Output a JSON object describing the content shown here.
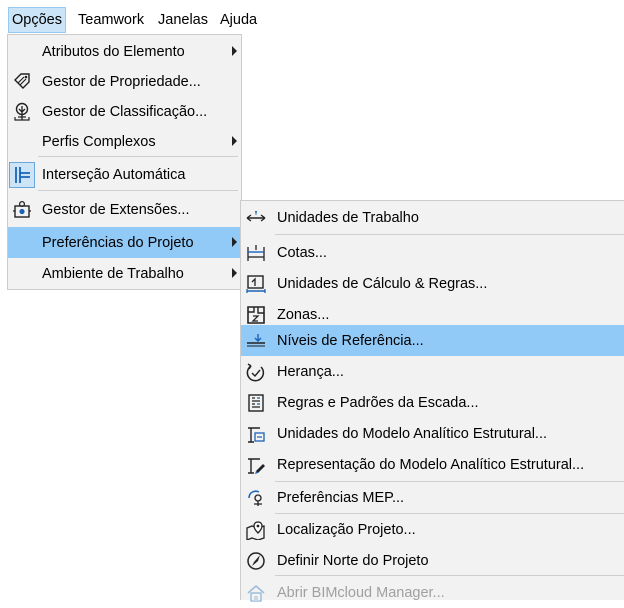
{
  "menubar": {
    "items": [
      {
        "label": "Opções",
        "active": true
      },
      {
        "label": "Teamwork"
      },
      {
        "label": "Janelas"
      },
      {
        "label": "Ajuda"
      }
    ]
  },
  "options_menu": {
    "items": [
      {
        "label": "Atributos do Elemento",
        "icon": "none",
        "submenu": true
      },
      {
        "label": "Gestor de Propriedade...",
        "icon": "tag-icon"
      },
      {
        "label": "Gestor de Classificação...",
        "icon": "classification-tree-icon"
      },
      {
        "label": "Perfis Complexos",
        "icon": "none",
        "submenu": true
      },
      {
        "label": "Interseção Automática",
        "icon": "auto-intersection-icon",
        "checked": true
      },
      {
        "label": "Gestor de Extensões...",
        "icon": "puzzle-icon",
        "mnemonic": "x"
      },
      {
        "label": "Preferências do Projeto",
        "icon": "none",
        "submenu": true,
        "highlighted": true
      },
      {
        "label": "Ambiente de Trabalho",
        "icon": "none",
        "submenu": true
      }
    ]
  },
  "project_preferences_menu": {
    "items": [
      {
        "label": "Unidades de Trabalho",
        "icon": "working-units-icon"
      },
      {
        "label": "Cotas...",
        "icon": "dimensions-icon",
        "mnemonic": "C"
      },
      {
        "label": "Unidades de Cálculo & Regras...",
        "icon": "calculation-units-icon",
        "mnemonic": "á"
      },
      {
        "label": "Zonas...",
        "icon": "zones-icon",
        "mnemonic": "Z"
      },
      {
        "label": "Níveis de Referência...",
        "icon": "reference-levels-icon",
        "highlighted": true
      },
      {
        "label": "Herança...",
        "icon": "inheritance-icon",
        "mnemonic": "H"
      },
      {
        "label": "Regras e Padrões da Escada...",
        "icon": "stair-rules-icon"
      },
      {
        "label": "Unidades do Modelo Analítico Estrutural...",
        "icon": "structural-units-icon"
      },
      {
        "label": "Representação do Modelo Analítico Estrutural...",
        "icon": "structural-representation-icon"
      },
      {
        "label": "Preferências MEP...",
        "icon": "mep-icon"
      },
      {
        "label": "Localização Projeto...",
        "icon": "location-icon"
      },
      {
        "label": "Definir Norte do Projeto",
        "icon": "compass-icon"
      },
      {
        "label": "Abrir BIMcloud Manager...",
        "icon": "bimcloud-icon",
        "disabled": true
      }
    ]
  },
  "colors": {
    "highlight": "#91c9f7",
    "menu_bg": "#f2f2f2",
    "icon_blue": "#1a63b8"
  }
}
